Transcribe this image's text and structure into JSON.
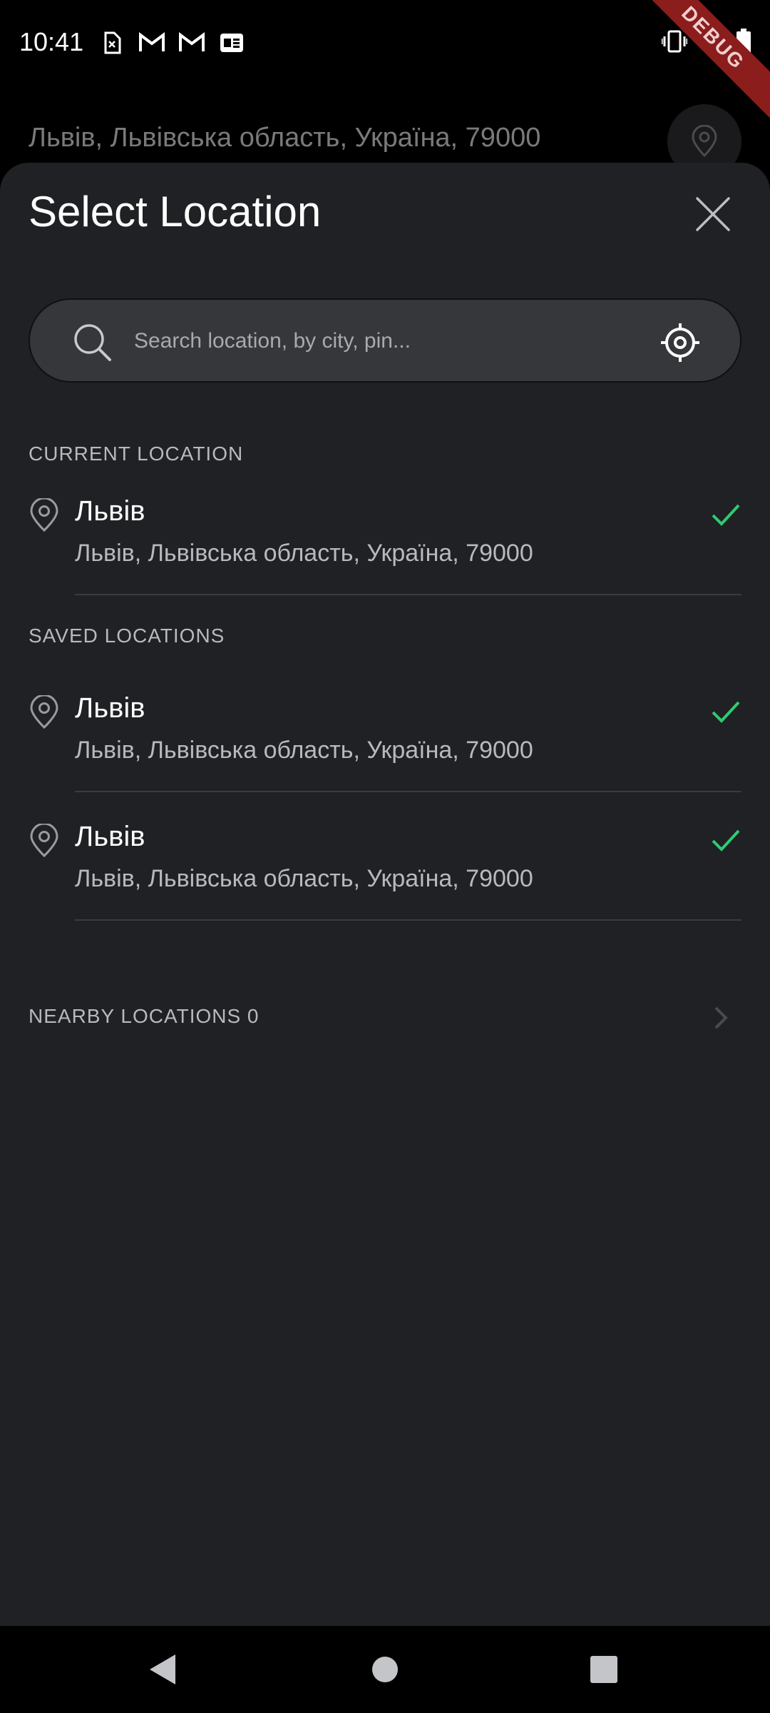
{
  "status_bar": {
    "time": "10:41",
    "left_icons": [
      "sim-icon",
      "gmail-icon",
      "gmail-icon",
      "news-icon"
    ],
    "right_icons": [
      "vibrate-icon",
      "wifi-icon",
      "battery-icon"
    ],
    "debug_banner": "DEBUG"
  },
  "background": {
    "address": "Львів, Львівська область, Україна, 79000"
  },
  "sheet": {
    "title": "Select Location",
    "search": {
      "placeholder": "Search location, by city, pin...",
      "value": ""
    },
    "current_section_label": "CURRENT LOCATION",
    "current_location": {
      "name": "Львів",
      "address": "Львів, Львівська область, Україна, 79000"
    },
    "saved_section_label": "SAVED LOCATIONS",
    "saved_locations": [
      {
        "name": "Львів",
        "address": "Львів, Львівська область, Україна, 79000"
      },
      {
        "name": "Львів",
        "address": "Львів, Львівська область, Україна, 79000"
      }
    ],
    "nearby_label": "NEARBY LOCATIONS 0"
  },
  "colors": {
    "accent_check": "#2ecc71",
    "sheet_bg": "#202124",
    "search_bg": "#36373a"
  }
}
